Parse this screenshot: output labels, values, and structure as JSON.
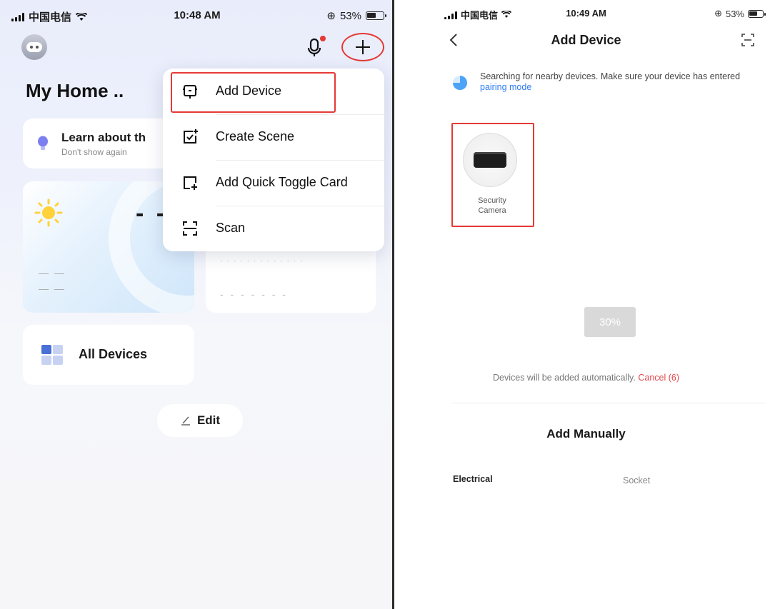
{
  "left": {
    "status": {
      "carrier": "中国电信",
      "time": "10:48 AM",
      "battery": "53%"
    },
    "home_title": "My Home ..",
    "learn_card": {
      "title": "Learn about th",
      "subtitle": "Don't show again"
    },
    "weather": {
      "temp": "- -",
      "line1": "— —",
      "line2": "— —"
    },
    "right_card": {
      "line1": "· · · · · · · · · · · · ·",
      "line2": "- - - - - - -"
    },
    "all_devices_label": "All Devices",
    "edit_label": "Edit",
    "menu": {
      "items": [
        {
          "label": "Add Device",
          "icon": "add-device-icon"
        },
        {
          "label": "Create Scene",
          "icon": "create-scene-icon"
        },
        {
          "label": "Add Quick Toggle Card",
          "icon": "quick-toggle-icon"
        },
        {
          "label": "Scan",
          "icon": "scan-icon"
        }
      ]
    },
    "colors": {
      "highlight": "#e53935",
      "grid_blue": "#4a6fd6",
      "grid_light": "#c7d2f3"
    }
  },
  "right": {
    "status": {
      "carrier": "中国电信",
      "time": "10:49 AM",
      "battery": "53%"
    },
    "title": "Add Device",
    "search_text": "Searching for nearby devices. Make sure your device has entered",
    "pairing_link": "pairing mode",
    "device": {
      "name_line1": "Security",
      "name_line2": "Camera"
    },
    "progress": "30%",
    "auto_text": "Devices will be added automatically.",
    "cancel_text": "Cancel (6)",
    "manual_title": "Add Manually",
    "category_left": "Electrical",
    "category_right": "Socket",
    "colors": {
      "link": "#2f7df6",
      "cancel": "#e5484d"
    }
  }
}
